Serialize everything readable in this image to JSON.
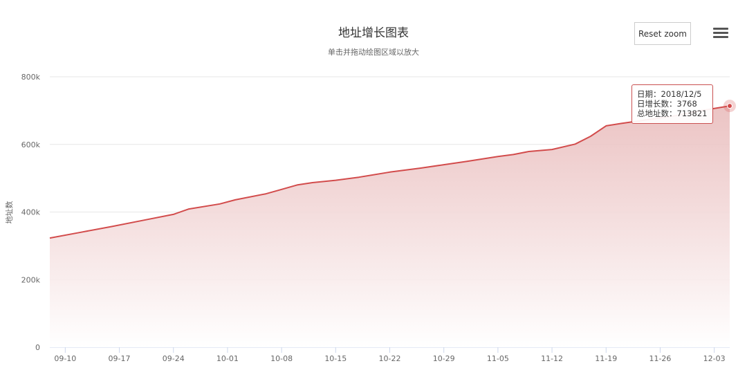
{
  "header": {
    "title": "地址增长图表",
    "subtitle": "单击并拖动绘图区域以放大",
    "reset_zoom_label": "Reset zoom",
    "menu_icon": "hamburger-menu-icon"
  },
  "colors": {
    "series_line": "#d24b4b",
    "area_top": "#e8b9b9",
    "area_bottom": "#ffffff",
    "grid": "#e6e6e6",
    "axis_text": "#666666"
  },
  "tooltip": {
    "date_row": "日期：2018/12/5",
    "daily_row": "日增长数：3768",
    "total_row": "总地址数：713821"
  },
  "chart_data": {
    "type": "area",
    "title": "地址增长图表",
    "subtitle": "单击并拖动绘图区域以放大",
    "xlabel": "",
    "ylabel": "地址数",
    "ylim": [
      0,
      800000
    ],
    "y_ticks": [
      0,
      200000,
      400000,
      600000,
      800000
    ],
    "y_tick_labels": [
      "0",
      "200k",
      "400k",
      "600k",
      "800k"
    ],
    "x_tick_labels": [
      "09-10",
      "09-17",
      "09-24",
      "10-01",
      "10-08",
      "10-15",
      "10-22",
      "10-29",
      "11-05",
      "11-12",
      "11-19",
      "11-26",
      "12-03"
    ],
    "x_range": [
      "2018-09-08",
      "2018-12-05"
    ],
    "grid": true,
    "legend": "none",
    "series": [
      {
        "x": [
          "2018-09-08",
          "2018-09-12",
          "2018-09-16",
          "2018-09-20",
          "2018-09-24",
          "2018-09-26",
          "2018-09-30",
          "2018-10-02",
          "2018-10-06",
          "2018-10-08",
          "2018-10-10",
          "2018-10-12",
          "2018-10-15",
          "2018-10-18",
          "2018-10-22",
          "2018-10-26",
          "2018-10-29",
          "2018-11-01",
          "2018-11-05",
          "2018-11-07",
          "2018-11-09",
          "2018-11-12",
          "2018-11-15",
          "2018-11-17",
          "2018-11-19",
          "2018-11-21",
          "2018-11-24",
          "2018-11-28",
          "2018-12-01",
          "2018-12-05"
        ],
        "values": [
          323000,
          340000,
          357000,
          375000,
          393000,
          409000,
          424000,
          436000,
          454000,
          467000,
          480000,
          487000,
          494000,
          503000,
          518000,
          530000,
          540000,
          550000,
          564000,
          570000,
          579000,
          585000,
          601000,
          624000,
          655000,
          662000,
          672000,
          685000,
          699000,
          713821
        ]
      }
    ],
    "highlighted_point": {
      "x": "2018-12-05",
      "value": 713821
    }
  }
}
